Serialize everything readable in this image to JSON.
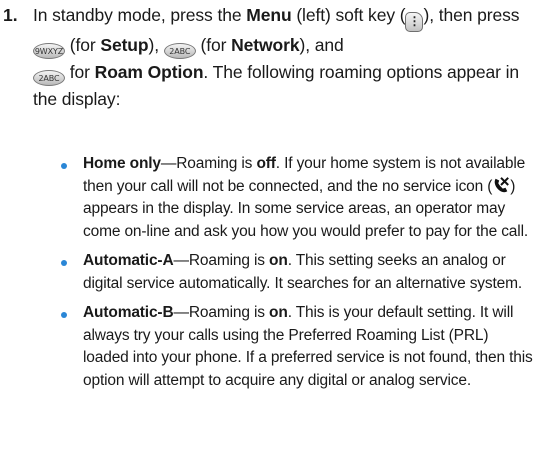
{
  "step": {
    "number": "1.",
    "t1": "In standby mode, press the ",
    "menu_word": "Menu",
    "t2": " (left) soft key (",
    "t3": "), then press ",
    "t4": " (for ",
    "setup_word": "Setup",
    "t5": "), ",
    "t6": " (for ",
    "network_word": "Network",
    "t7": "), and ",
    "t8": " for ",
    "roam_word": "Roam Option",
    "t9": ". The following roaming options appear in the display:",
    "key9_label": "9WXYZ",
    "key2_label": "2ABC",
    "key2b_label": "2ABC"
  },
  "options": [
    {
      "name": "Home only",
      "dash": "—Roaming is ",
      "state": "off",
      "p1": ". If your home system is not available then your call will not be connected, and the no service icon (",
      "p2": ") appears in the display. In some service areas, an operator may come on-line and ask you how you would prefer to pay for the call."
    },
    {
      "name": "Automatic-A",
      "dash": "—Roaming is ",
      "state": "on",
      "p1": ". This setting seeks an analog or digital service automatically. It searches for an alternative system."
    },
    {
      "name": "Automatic-B",
      "dash": "—Roaming is ",
      "state": "on",
      "p1": ". This is your default setting. It will always try your calls using the Preferred Roaming List (PRL) loaded into your phone. If a preferred service is not found, then this option will attempt to acquire any digital or analog service."
    }
  ],
  "colors": {
    "bullet": "#2a86d6",
    "text": "#1a1a1a"
  },
  "icons": [
    "menu-softkey-icon",
    "key-9-icon",
    "key-2-icon",
    "no-service-icon"
  ]
}
